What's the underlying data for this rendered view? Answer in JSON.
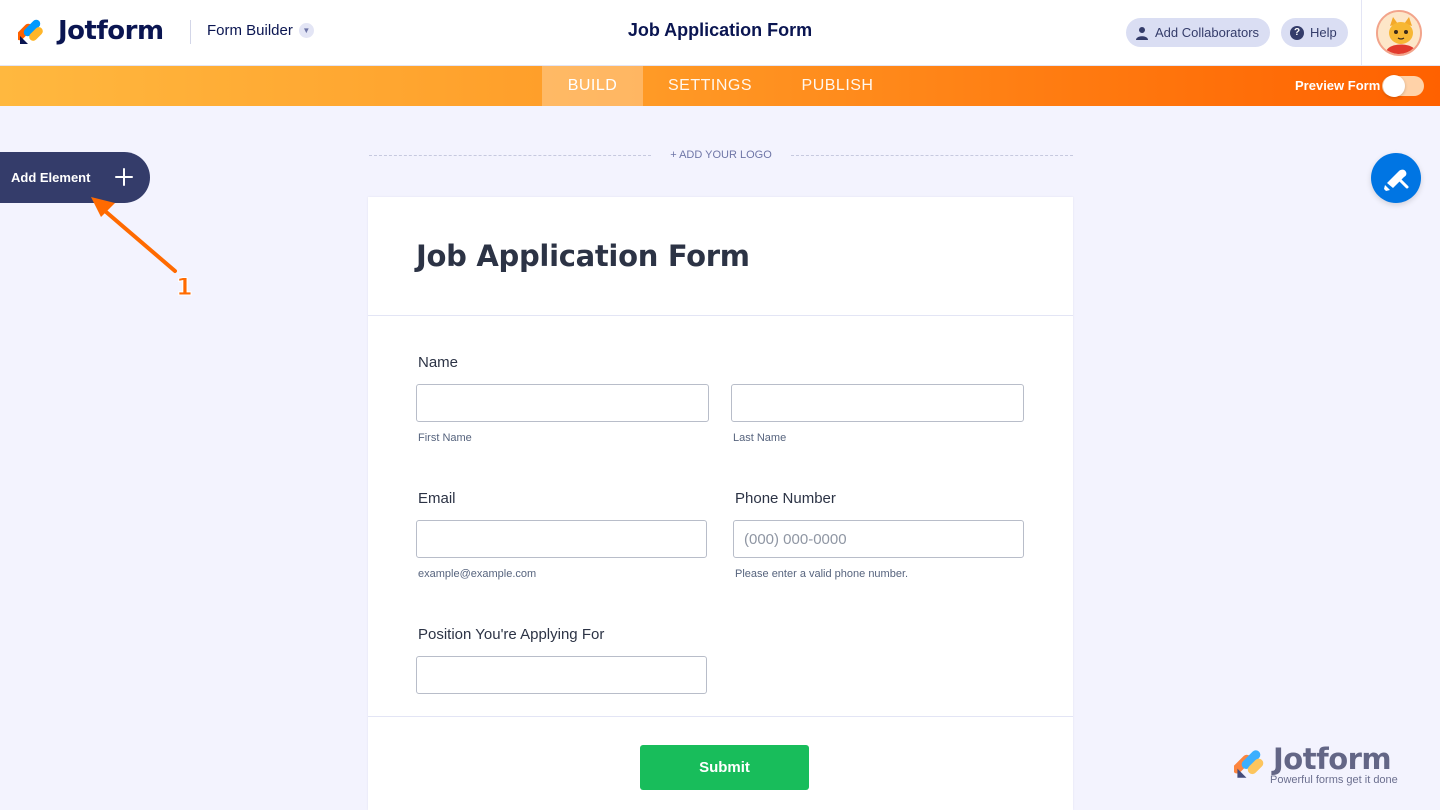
{
  "header": {
    "brand": "Jotform",
    "builder_label": "Form Builder",
    "title": "Job Application Form",
    "collaborators_label": "Add Collaborators",
    "help_label": "Help",
    "avatar_icon": "user-avatar-icon"
  },
  "nav": {
    "tabs": [
      {
        "label": "BUILD",
        "active": true
      },
      {
        "label": "SETTINGS",
        "active": false
      },
      {
        "label": "PUBLISH",
        "active": false
      }
    ],
    "preview_label": "Preview Form",
    "preview_on": false,
    "colors": {
      "gradient_start": "#ffb83f",
      "gradient_end": "#ff6100"
    }
  },
  "sidebar": {
    "add_element_label": "Add Element",
    "annotation_number": "1"
  },
  "canvas": {
    "add_logo_label": "+ ADD YOUR LOGO",
    "form": {
      "title": "Job Application Form",
      "fields": {
        "name": {
          "label": "Name",
          "first_sub": "First Name",
          "last_sub": "Last Name",
          "first_value": "",
          "last_value": ""
        },
        "email": {
          "label": "Email",
          "value": "",
          "sub": "example@example.com"
        },
        "phone": {
          "label": "Phone Number",
          "placeholder": "(000) 000-0000",
          "sub": "Please enter a valid phone number."
        },
        "position": {
          "label": "Position You're Applying For",
          "value": ""
        }
      },
      "submit_label": "Submit",
      "submit_color": "#18bd5b"
    }
  },
  "watermark": {
    "brand": "Jotform",
    "tagline": "Powerful forms get it done"
  }
}
